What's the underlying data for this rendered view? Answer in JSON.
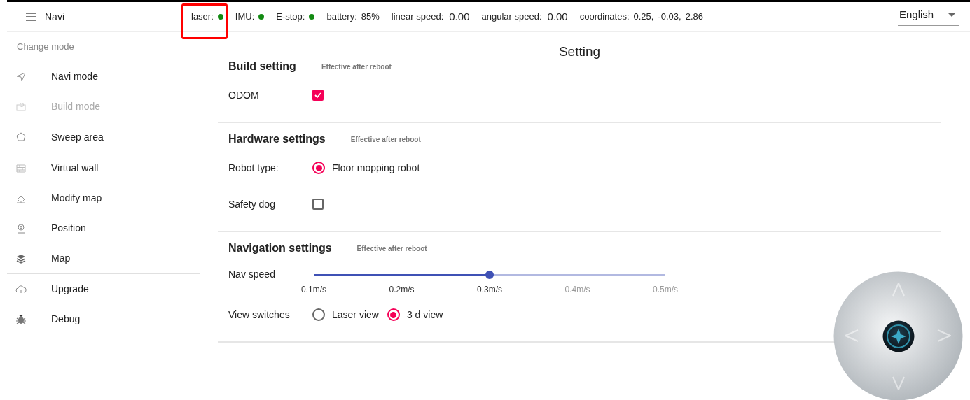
{
  "header": {
    "title": "Navi",
    "status": [
      {
        "kind": "dot",
        "label": "laser:",
        "color": "#128a12",
        "highlighted": true
      },
      {
        "kind": "dot",
        "label": "IMU:",
        "color": "#128a12",
        "highlighted": false
      },
      {
        "kind": "dot",
        "label": "E-stop:",
        "color": "#128a12",
        "highlighted": false
      },
      {
        "kind": "text",
        "label": "battery:",
        "value": "85%",
        "highlighted": false
      },
      {
        "kind": "number",
        "label": "linear speed:",
        "value": "0.00",
        "highlighted": false
      },
      {
        "kind": "number",
        "label": "angular speed:",
        "value": "0.00",
        "highlighted": false
      },
      {
        "kind": "list",
        "label": "coordinates:",
        "values": [
          "0.25,",
          "-0.03,",
          "2.86"
        ],
        "highlighted": false
      }
    ],
    "language": "English"
  },
  "sidebar": {
    "section_label": "Change mode",
    "groups": [
      [
        {
          "label": "Navi mode",
          "disabled": false
        },
        {
          "label": "Build mode",
          "disabled": true
        }
      ],
      [
        {
          "label": "Sweep area",
          "disabled": false
        },
        {
          "label": "Virtual wall",
          "disabled": false
        },
        {
          "label": "Modify map",
          "disabled": false
        },
        {
          "label": "Position",
          "disabled": false
        },
        {
          "label": "Map",
          "disabled": false
        }
      ],
      [
        {
          "label": "Upgrade",
          "disabled": false
        },
        {
          "label": "Debug",
          "disabled": false
        }
      ]
    ]
  },
  "page": {
    "title": "Setting",
    "sections": [
      {
        "title": "Build setting",
        "note": "Effective after reboot",
        "rows": [
          {
            "kind": "checkbox",
            "label": "ODOM",
            "checked": true
          }
        ]
      },
      {
        "title": "Hardware settings",
        "note": "Effective after reboot",
        "rows": [
          {
            "kind": "radio",
            "label": "Robot type:",
            "options": [
              {
                "label": "Floor mopping robot",
                "selected": true
              }
            ]
          },
          {
            "kind": "checkbox",
            "label": "Safety dog",
            "checked": false
          }
        ]
      },
      {
        "title": "Navigation settings",
        "note": "Effective after reboot",
        "rows": [
          {
            "kind": "slider",
            "label": "Nav speed",
            "level": 0.5,
            "ticks": [
              "0.1m/s",
              "0.2m/s",
              "0.3m/s",
              "0.4m/s",
              "0.5m/s"
            ]
          },
          {
            "kind": "radio",
            "label": "View switches",
            "options": [
              {
                "label": "Laser view",
                "selected": false
              },
              {
                "label": "3 d view",
                "selected": true
              }
            ]
          }
        ]
      }
    ]
  }
}
